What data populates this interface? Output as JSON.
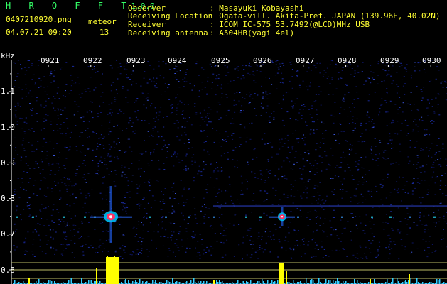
{
  "header": {
    "app_title": "H R O F F T",
    "version": "1.0.0",
    "filename": "0407210920.png",
    "counter_label": "meteor",
    "datetime": "04.07.21 09:20",
    "meteor_count": "13",
    "info": [
      {
        "label": "Observer",
        "value": ": Masayuki Kobayashi"
      },
      {
        "label": "Receiving Location",
        "value": ": Ogata-vill. Akita-Pref. JAPAN (139.96E, 40.02N)"
      },
      {
        "label": "Receiver",
        "value": ": ICOM IC-575 53.7492(@LCD)MHz USB"
      },
      {
        "label": "Receiving antenna",
        "value": ": A504HB(yagi 4el)"
      }
    ]
  },
  "spectrogram": {
    "y_unit": "kHz",
    "y_ticks": [
      "1.1",
      "1.0",
      "0.9",
      "0.8",
      "0.7",
      "0.6"
    ],
    "time_labels": [
      "0921",
      "0922",
      "0923",
      "0924",
      "0925",
      "0926",
      "0927",
      "0928",
      "0929",
      "0930"
    ],
    "colors": {
      "background": "#000000",
      "noise": "#1a2a9a",
      "echo_core": "#ff3366",
      "echo_halo": "#00c8ff",
      "text_white": "#ffffff",
      "text_yellow": "#ffff33",
      "text_green": "#33ff66",
      "baseline_yellow": "#ffff00",
      "baseline_cyan": "#33ccff",
      "ref_lines": "#bbbb66"
    },
    "events": [
      {
        "time": "0922",
        "frequency_khz": 0.75
      },
      {
        "time": "0926",
        "frequency_khz": 0.75
      }
    ]
  }
}
